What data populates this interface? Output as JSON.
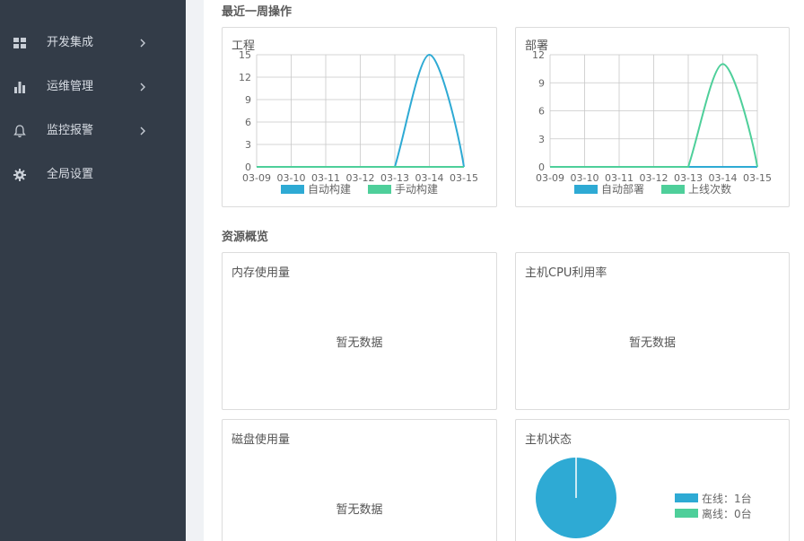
{
  "sidebar": {
    "items": [
      {
        "label": "开发集成",
        "icon": "grid-icon",
        "has_children": true
      },
      {
        "label": "运维管理",
        "icon": "bar-chart-icon",
        "has_children": true
      },
      {
        "label": "监控报警",
        "icon": "bell-icon",
        "has_children": true
      },
      {
        "label": "全局设置",
        "icon": "gear-icon",
        "has_children": false
      }
    ]
  },
  "sections": {
    "recent_ops": "最近一周操作",
    "resources": "资源概览"
  },
  "colors": {
    "series_a": "#2eaad4",
    "series_b": "#4ecf9a",
    "sidebar_bg": "#333c48"
  },
  "chart_data": [
    {
      "type": "line",
      "title": "工程",
      "x": [
        "03-09",
        "03-10",
        "03-11",
        "03-12",
        "03-13",
        "03-14",
        "03-15"
      ],
      "ylim": [
        0,
        15
      ],
      "yticks": [
        0,
        3,
        6,
        9,
        12,
        15
      ],
      "series": [
        {
          "name": "自动构建",
          "values": [
            0,
            0,
            0,
            0,
            0,
            15,
            0
          ]
        },
        {
          "name": "手动构建",
          "values": [
            0,
            0,
            0,
            0,
            0,
            0,
            0
          ]
        }
      ],
      "legend": "bottom",
      "grid": true
    },
    {
      "type": "line",
      "title": "部署",
      "x": [
        "03-09",
        "03-10",
        "03-11",
        "03-12",
        "03-13",
        "03-14",
        "03-15"
      ],
      "ylim": [
        0,
        12
      ],
      "yticks": [
        0,
        3,
        6,
        9,
        12
      ],
      "series": [
        {
          "name": "自动部署",
          "values": [
            0,
            0,
            0,
            0,
            0,
            0,
            0
          ]
        },
        {
          "name": "上线次数",
          "values": [
            0,
            0,
            0,
            0,
            0,
            11,
            0
          ]
        }
      ],
      "legend": "bottom",
      "grid": true
    },
    {
      "type": "pie",
      "title": "主机状态",
      "categories": [
        "在线：1台",
        "离线：0台"
      ],
      "values": [
        1,
        0
      ],
      "legend": "right"
    }
  ],
  "resources": {
    "memory": {
      "title": "内存使用量",
      "empty": "暂无数据"
    },
    "cpu": {
      "title": "主机CPU利用率",
      "empty": "暂无数据"
    },
    "disk": {
      "title": "磁盘使用量",
      "empty": "暂无数据"
    },
    "host_status": {
      "title": "主机状态"
    }
  }
}
